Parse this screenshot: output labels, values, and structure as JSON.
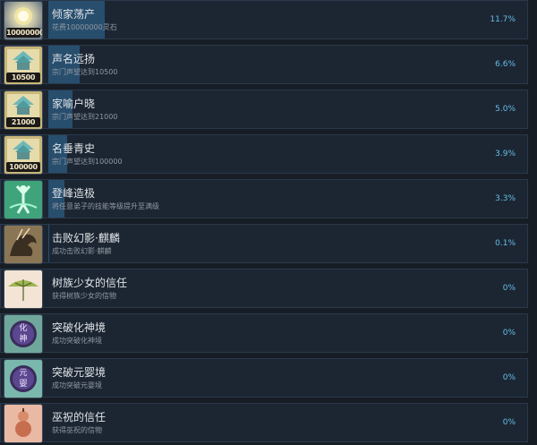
{
  "achievements": [
    {
      "title": "倾家荡产",
      "desc": "花费10000000灵石",
      "percent": "11.7%",
      "progress": 11.7,
      "icon": "gold-coin-icon",
      "badge": "10000000"
    },
    {
      "title": "声名远扬",
      "desc": "宗门声望达到10500",
      "percent": "6.6%",
      "progress": 6.6,
      "icon": "sect-hall-emblem-icon",
      "badge": "10500"
    },
    {
      "title": "家喻户晓",
      "desc": "宗门声望达到21000",
      "percent": "5.0%",
      "progress": 5.0,
      "icon": "sect-hall-emblem-icon",
      "badge": "21000"
    },
    {
      "title": "名垂青史",
      "desc": "宗门声望达到100000",
      "percent": "3.9%",
      "progress": 3.9,
      "icon": "sect-hall-emblem-icon",
      "badge": "100000"
    },
    {
      "title": "登峰造极",
      "desc": "将任意弟子的技能等级提升至满级",
      "percent": "3.3%",
      "progress": 3.3,
      "icon": "ascending-figure-icon",
      "badge": ""
    },
    {
      "title": "击败幻影·麒麟",
      "desc": "成功击败幻影·麒麟",
      "percent": "0.1%",
      "progress": 0.1,
      "icon": "qilin-beast-icon",
      "badge": ""
    },
    {
      "title": "树族少女的信任",
      "desc": "获得树族少女的信物",
      "percent": "0%",
      "progress": 0,
      "icon": "leaf-umbrella-icon",
      "badge": ""
    },
    {
      "title": "突破化神境",
      "desc": "成功突破化神境",
      "percent": "0%",
      "progress": 0,
      "icon": "realm-orb-huashen-icon",
      "badge": ""
    },
    {
      "title": "突破元婴境",
      "desc": "成功突破元婴境",
      "percent": "0%",
      "progress": 0,
      "icon": "realm-orb-yuanying-icon",
      "badge": ""
    },
    {
      "title": "巫祝的信任",
      "desc": "获得巫祝的信物",
      "percent": "0%",
      "progress": 0,
      "icon": "gourd-token-icon",
      "badge": ""
    }
  ],
  "realm_glyphs": {
    "huashen": [
      "化",
      "神"
    ],
    "yuanying": [
      "元",
      "婴"
    ]
  },
  "colors": {
    "background": "#171d25",
    "row": "#1c2633",
    "progress_bar": "#284e6e",
    "percent_text": "#66bde8"
  }
}
